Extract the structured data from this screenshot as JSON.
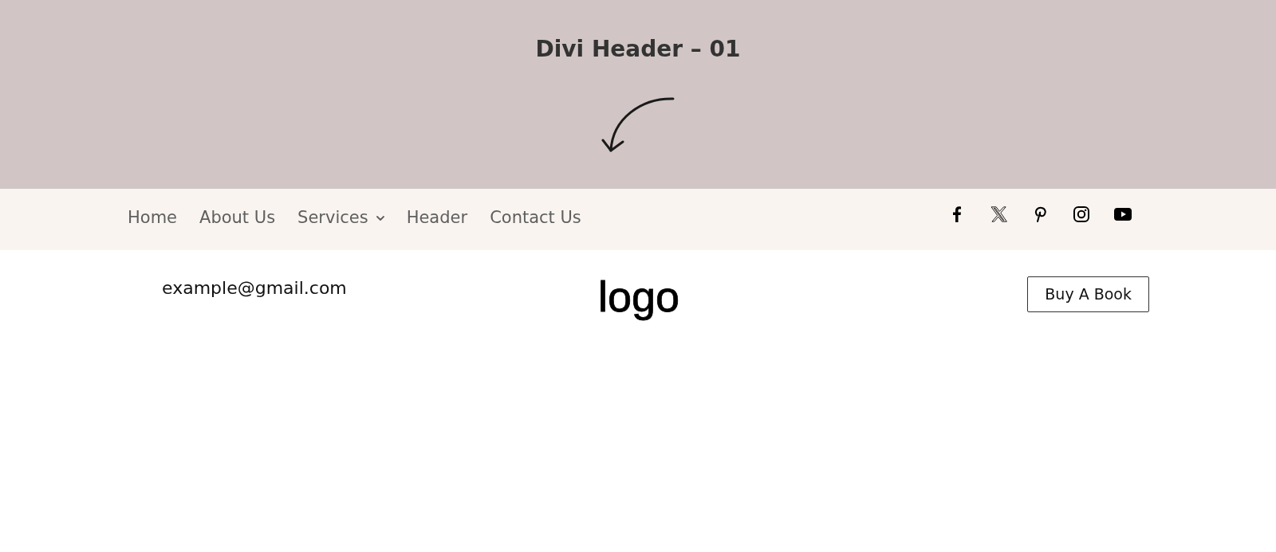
{
  "banner": {
    "title": "Divi Header – 01"
  },
  "nav": {
    "items": [
      {
        "label": "Home",
        "has_submenu": false
      },
      {
        "label": "About Us",
        "has_submenu": false
      },
      {
        "label": "Services",
        "has_submenu": true
      },
      {
        "label": "Header",
        "has_submenu": false
      },
      {
        "label": "Contact Us",
        "has_submenu": false
      }
    ]
  },
  "header_row": {
    "email": "example@gmail.com",
    "logo": "logo",
    "button": "Buy A Book"
  }
}
